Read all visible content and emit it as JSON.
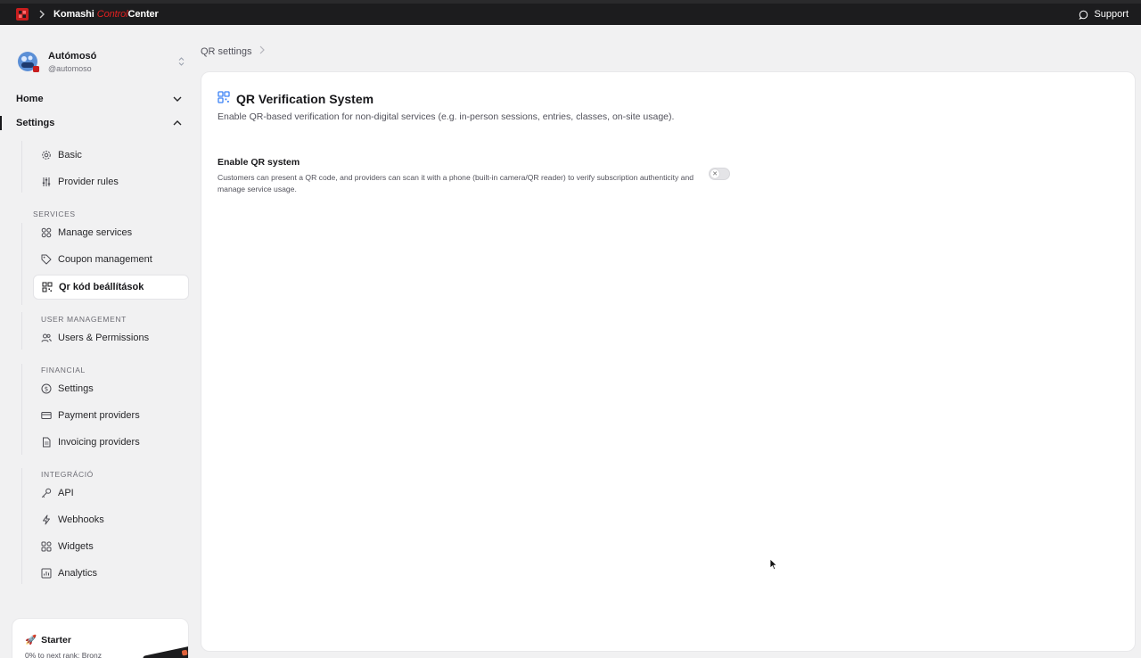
{
  "topbar": {
    "brand_first": "Komashi",
    "brand_accent": "Control",
    "brand_last": "Center",
    "support_label": "Support"
  },
  "account": {
    "name": "Autómosó",
    "handle": "@automoso"
  },
  "nav": {
    "home": "Home",
    "settings": "Settings"
  },
  "sidebar": {
    "basic": "Basic",
    "provider_rules": "Provider rules",
    "services_label": "SERVICES",
    "manage_services": "Manage services",
    "coupon_management": "Coupon management",
    "qr_settings": "Qr kód beállítások",
    "user_mgmt_label": "USER MANAGEMENT",
    "users_permissions": "Users & Permissions",
    "financial_label": "FINANCIAL",
    "fin_settings": "Settings",
    "payment_providers": "Payment providers",
    "invoicing_providers": "Invoicing providers",
    "integration_label": "INTEGRÁCIÓ",
    "api": "API",
    "webhooks": "Webhooks",
    "widgets": "Widgets",
    "analytics": "Analytics"
  },
  "plan": {
    "title": "Starter",
    "emoji": "🚀",
    "progress_text": "0% to next rank: Bronz"
  },
  "breadcrumb": {
    "current": "QR settings"
  },
  "main": {
    "title": "QR Verification System",
    "description": "Enable QR-based verification for non-digital services (e.g. in-person sessions, entries, classes, on-site usage).",
    "setting_title": "Enable QR system",
    "setting_description": "Customers can present a QR code, and providers can scan it with a phone (built-in camera/QR reader) to verify subscription authenticity and manage service usage.",
    "qr_enabled": false
  },
  "colors": {
    "brand_red": "#e02020",
    "topbar_bg": "#1c1c1e",
    "qr_icon_blue": "#3b82f6"
  }
}
